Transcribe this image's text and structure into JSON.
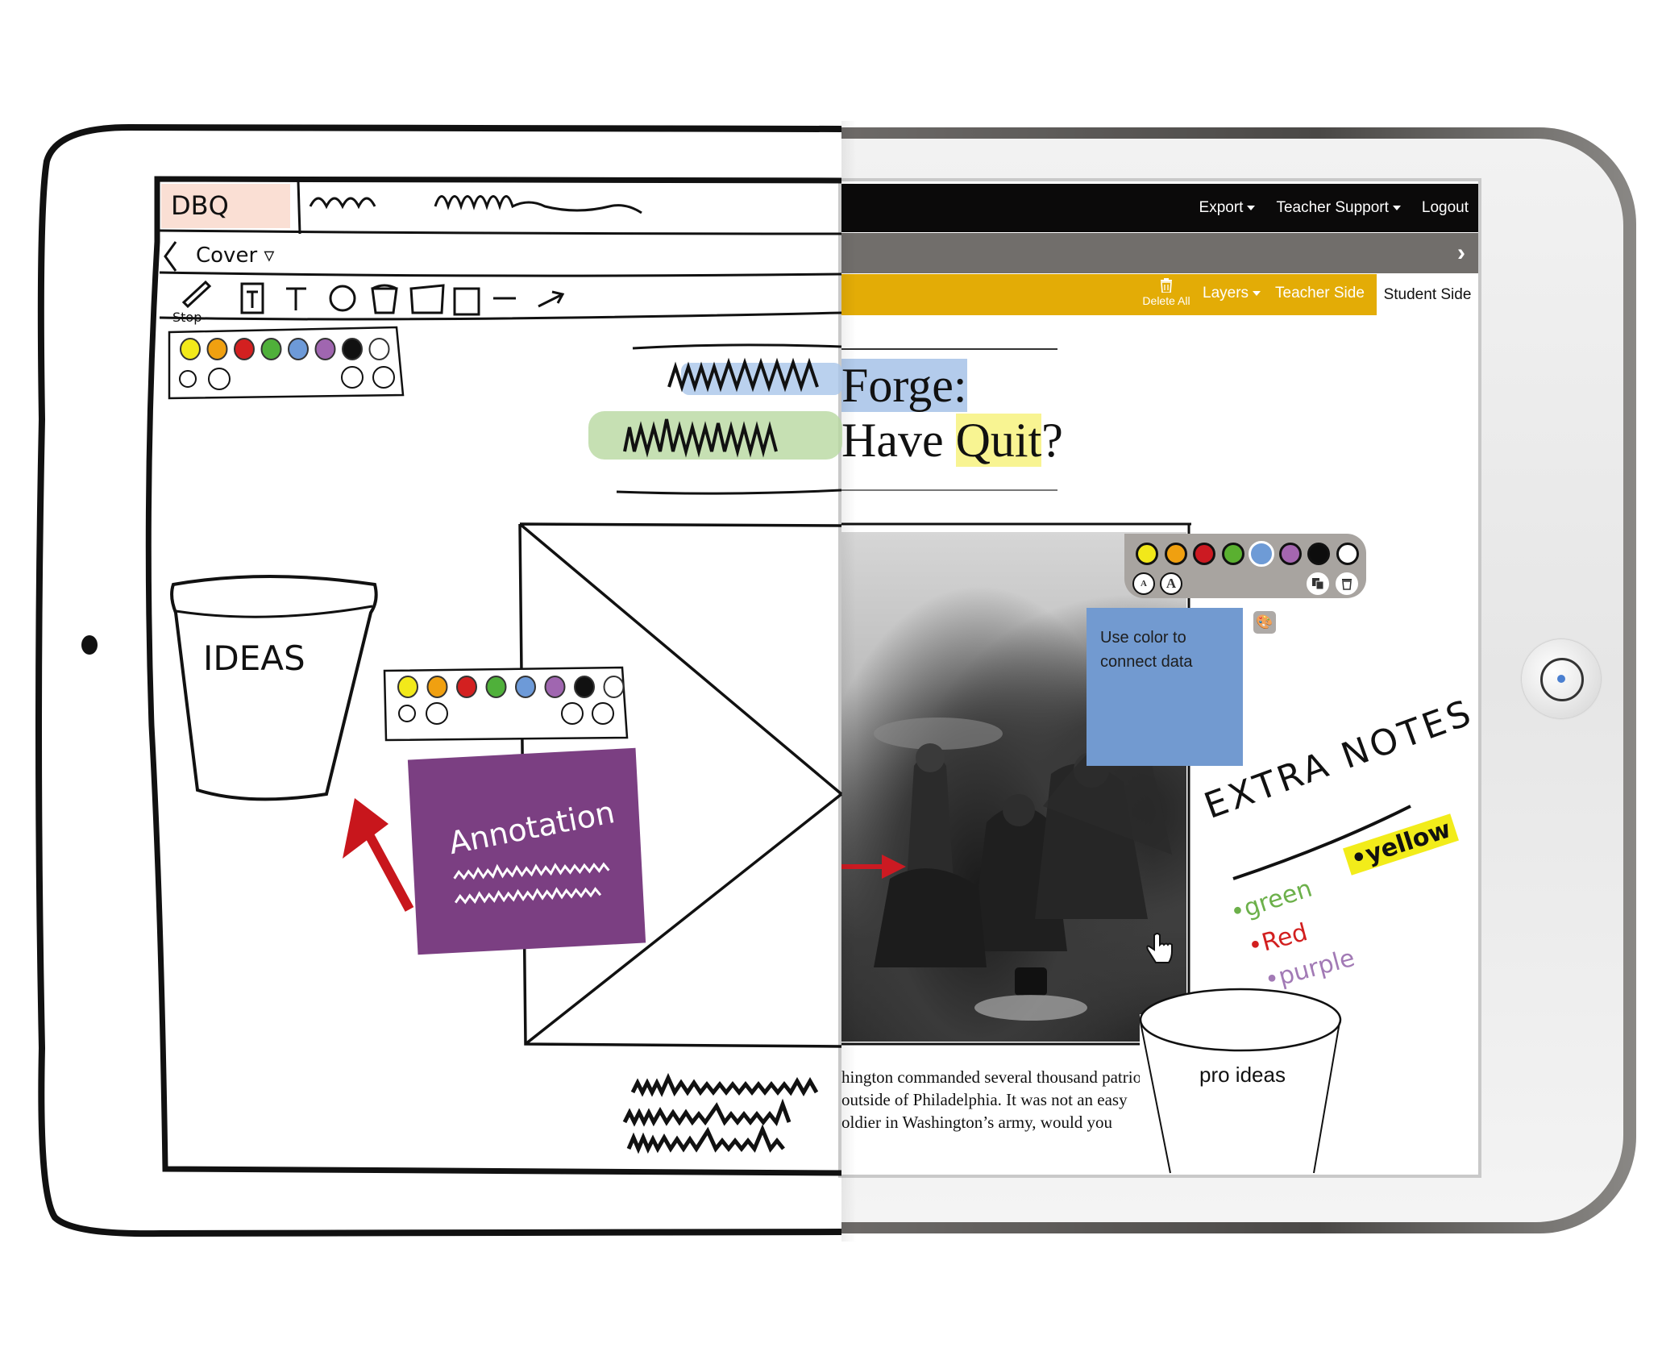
{
  "sketch": {
    "app_label": "DBQ",
    "nav_label": "Cover",
    "stop_label": "Stop",
    "bucket_label": "IDEAS",
    "annotation_label": "Annotation",
    "swatches": [
      "#f2e91a",
      "#f0a010",
      "#d32020",
      "#4fb03a",
      "#6d9ad8",
      "#a066b0",
      "#111111",
      "#ffffff"
    ],
    "tools": [
      "pencil",
      "text-box",
      "text",
      "circle",
      "bucket",
      "rectangle",
      "square",
      "line",
      "arrow"
    ]
  },
  "app": {
    "topbar": {
      "export_label": "Export",
      "teacher_support_label": "Teacher Support",
      "logout_label": "Logout"
    },
    "subbar": {
      "next_icon": "chevron-right"
    },
    "toolbar": {
      "delete_all_label": "Delete All",
      "layers_label": "Layers",
      "teacher_side_label": "Teacher Side",
      "student_side_label": "Student Side"
    },
    "document": {
      "title_line1": "Forge:",
      "title_line2_prefix": "Have ",
      "title_line2_highlight": "Quit",
      "title_line2_suffix": "?",
      "body_lines": [
        "hington commanded several thousand patrio",
        "outside of Philadelphia. It was not an easy",
        "oldier in Washington’s army, would you"
      ]
    },
    "palette": {
      "swatches": [
        {
          "name": "yellow",
          "color": "#f2e81a"
        },
        {
          "name": "orange",
          "color": "#f0a010"
        },
        {
          "name": "red",
          "color": "#cc1a22"
        },
        {
          "name": "green",
          "color": "#5ab030"
        },
        {
          "name": "blue",
          "color": "#6e9bd6",
          "selected": true
        },
        {
          "name": "purple",
          "color": "#a466b0"
        },
        {
          "name": "black",
          "color": "#0d0d0d"
        },
        {
          "name": "white",
          "color": "#ffffff"
        }
      ],
      "small_text_label": "A",
      "large_text_label": "A"
    },
    "sticky_note": {
      "text_line1": "Use color to",
      "text_line2": "connect data",
      "color": "#729ad0"
    },
    "extra_notes": {
      "heading": "EXTRA NOTES",
      "items": [
        {
          "label": "•yellow",
          "color": "#111111",
          "highlight": "#f2ec1a"
        },
        {
          "label": "•green",
          "color": "#6cb04a"
        },
        {
          "label": "•Red",
          "color": "#d21f1f"
        },
        {
          "label": "•purple",
          "color": "#a27ab5"
        }
      ]
    },
    "bucket_label": "pro ideas"
  },
  "colors": {
    "topbar": "#0b0a0a",
    "subbar": "#716e6b",
    "toolbar": "#e3ac06",
    "sticky": "#729ad0"
  }
}
